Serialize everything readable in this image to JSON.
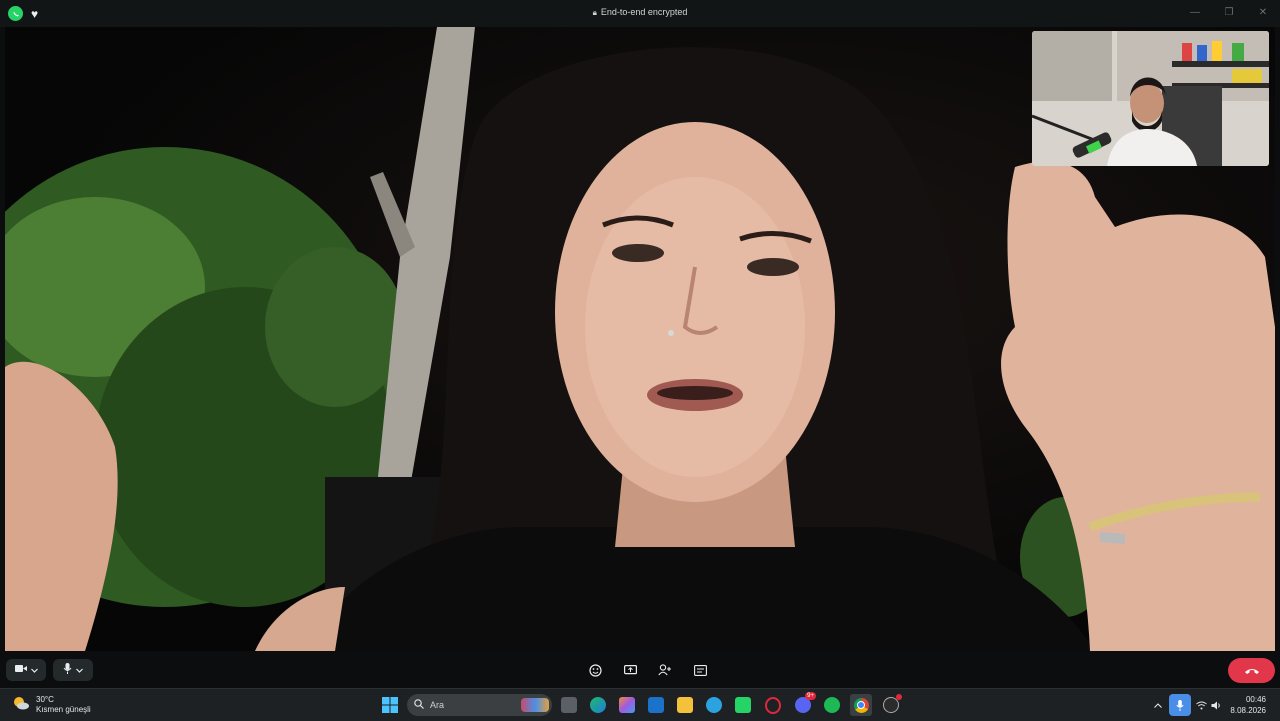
{
  "titlebar": {
    "center_text": "End-to-end encrypted",
    "icons": [
      "whatsapp-logo-icon",
      "heart-icon",
      "lock-icon",
      "minimize-icon",
      "maximize-icon",
      "close-icon"
    ]
  },
  "call_controls": {
    "left": [
      "video-camera-icon",
      "chevron-down-icon",
      "microphone-icon",
      "chevron-down-icon"
    ],
    "center": [
      "emoji-icon",
      "screen-share-icon",
      "add-person-icon",
      "more-options-icon"
    ],
    "end_call_icon": "phone-hangup-icon",
    "end_call_color": "#e2374b"
  },
  "taskbar": {
    "weather": {
      "temperature": "30°C",
      "condition": "Kısmen güneşli"
    },
    "search_placeholder": "Ara",
    "pinned_apps": [
      "windows-start-icon",
      "search-icon",
      "file-manager-icon",
      "edge-icon",
      "copilot-icon",
      "outlook-icon",
      "file-explorer-icon",
      "telegram-icon",
      "whatsapp-icon",
      "opera-icon",
      "discord-icon",
      "spotify-icon",
      "chrome-icon",
      "obs-icon"
    ],
    "discord_badge": "9+",
    "tray": [
      "chevron-up-icon",
      "microphone-icon",
      "wifi-icon",
      "speaker-icon"
    ],
    "clock": {
      "time": "00:46",
      "date": "8.08.2026"
    }
  },
  "colors": {
    "accent": "#25d366",
    "end_call": "#e2374b",
    "taskbar_bg": "#1d2124",
    "mic_tray_highlight": "#4a8fe7"
  }
}
